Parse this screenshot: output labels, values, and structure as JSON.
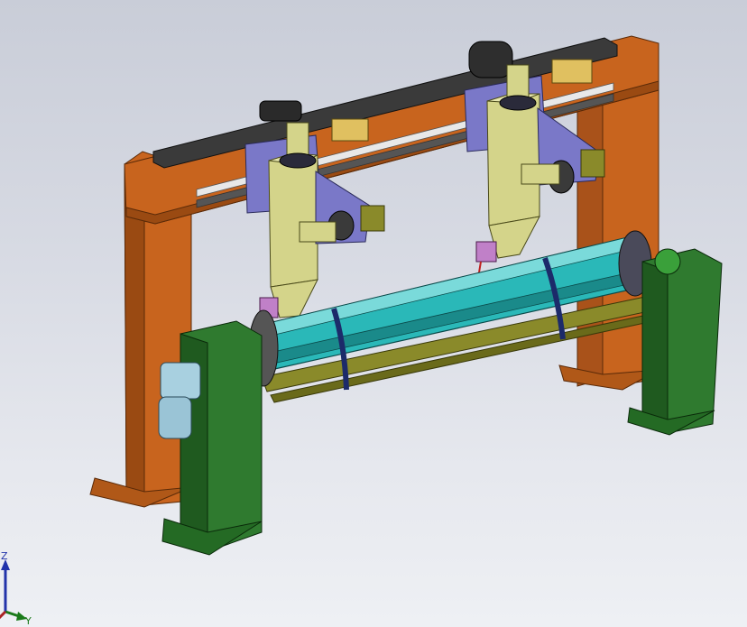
{
  "viewport": {
    "background_top": "#c9cdd8",
    "background_bottom": "#eef0f4"
  },
  "triad": {
    "z_label": "Z",
    "y_label": "Y",
    "z_color": "#2233aa",
    "y_color": "#1a7a1a"
  },
  "colors": {
    "frame": "#c8641e",
    "frame_shade": "#9a4a12",
    "rail": "#3a3a3a",
    "carriage": "#d4d48a",
    "plate": "#7a78c8",
    "bracket": "#8a8a2a",
    "tube": "#2ab8b8",
    "pedestal": "#2f7a2f",
    "motor": "#a8d0e0",
    "strap": "#1c2a6a"
  }
}
